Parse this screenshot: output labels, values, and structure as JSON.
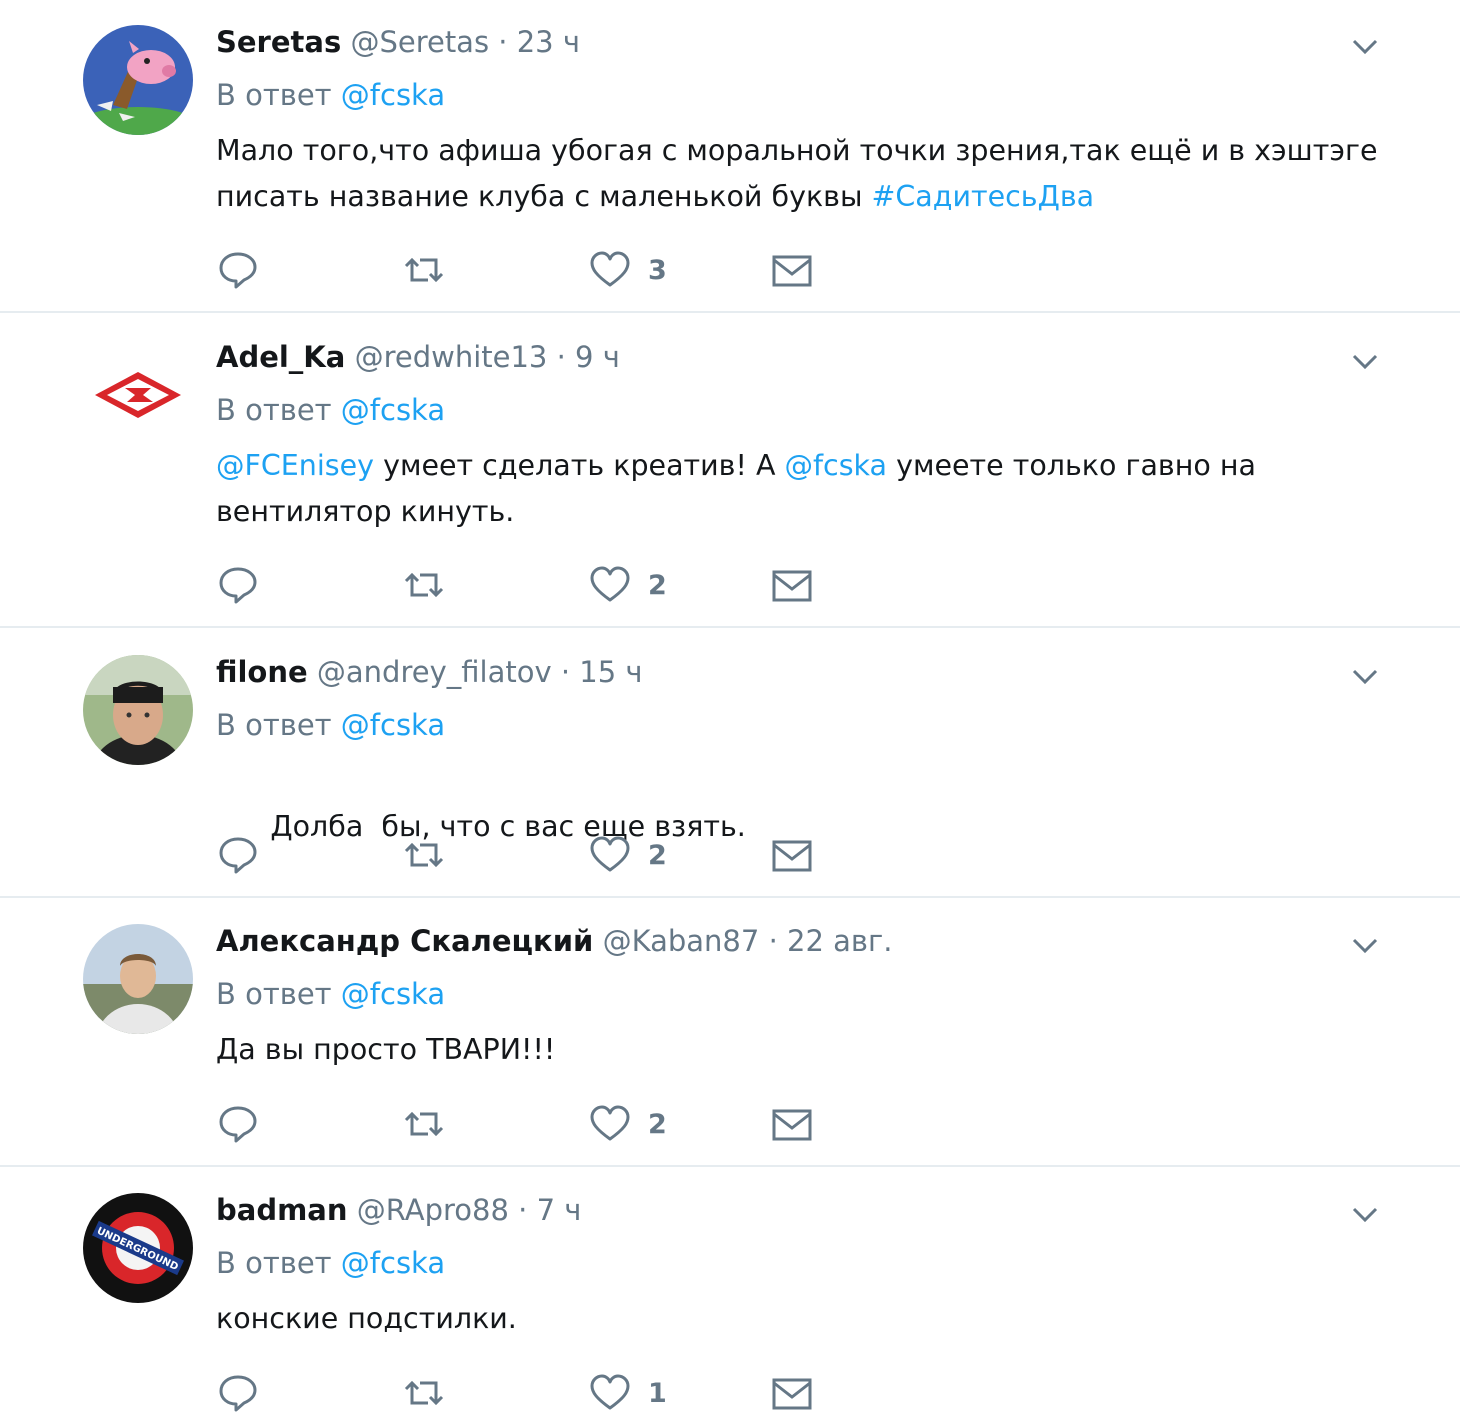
{
  "reply_prefix": "В ответ",
  "colors": {
    "link": "#1da1f2",
    "muted": "#657786",
    "text": "#14171a",
    "divider": "#e6ecf0"
  },
  "tweets": [
    {
      "name": "Seretas",
      "handle": "@Seretas",
      "time": "23 ч",
      "reply_to": "@fcska",
      "text_parts": [
        {
          "t": "Мало того,что афиша убогая с моральной точки зрения,так ещё и в хэштэге писать название клуба с маленькой буквы ",
          "link": false
        },
        {
          "t": "#СадитесьДва",
          "link": true
        }
      ],
      "likes": "3",
      "avatar_icon": "pink-pig-avatar-icon"
    },
    {
      "name": "Adel_Ka",
      "handle": "@redwhite13",
      "time": "9 ч",
      "reply_to": "@fcska",
      "text_parts": [
        {
          "t": "@FCEnisey",
          "link": true
        },
        {
          "t": " умеет сделать креатив! А ",
          "link": false
        },
        {
          "t": "@fcska",
          "link": true
        },
        {
          "t": " умеете только гавно на вентилятор кинуть.",
          "link": false
        }
      ],
      "likes": "2",
      "avatar_icon": "spartak-logo-icon"
    },
    {
      "name": "filone",
      "handle": "@andrey_filatov",
      "time": "15 ч",
      "reply_to": "@fcska",
      "text_parts": [
        {
          "t": "Долба  бы, что с вас еще взять.",
          "link": false
        }
      ],
      "likes": "2",
      "avatar_icon": "person-photo-icon"
    },
    {
      "name": "Александр Скалецкий",
      "handle": "@Kaban87",
      "time": "22 авг.",
      "reply_to": "@fcska",
      "text_parts": [
        {
          "t": "Да вы просто ТВАРИ!!!",
          "link": false
        }
      ],
      "likes": "2",
      "avatar_icon": "person-photo-icon"
    },
    {
      "name": "badman",
      "handle": "@RApro88",
      "time": "7 ч",
      "reply_to": "@fcska",
      "text_parts": [
        {
          "t": "конские подстилки.",
          "link": false
        }
      ],
      "likes": "1",
      "avatar_icon": "underground-logo-icon",
      "avatar_text": "UNDERGROUND"
    }
  ]
}
